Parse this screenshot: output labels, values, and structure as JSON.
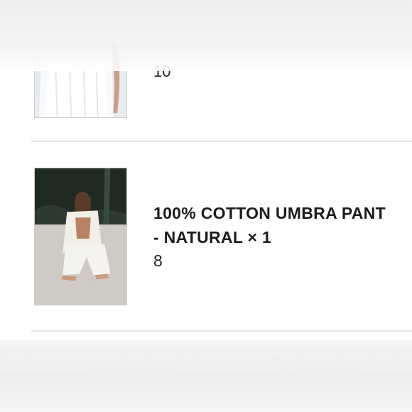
{
  "cart": {
    "items": [
      {
        "quantity_value": "10",
        "image_icon": "dress-photo-icon"
      },
      {
        "title": "100% COTTON UMBRA PANT\n- NATURAL × 1",
        "value": "8",
        "image_icon": "model-photo-icon"
      }
    ]
  },
  "colors": {
    "background": "#ffffff",
    "divider": "#e4e4e4",
    "text": "#1c1c1c"
  }
}
